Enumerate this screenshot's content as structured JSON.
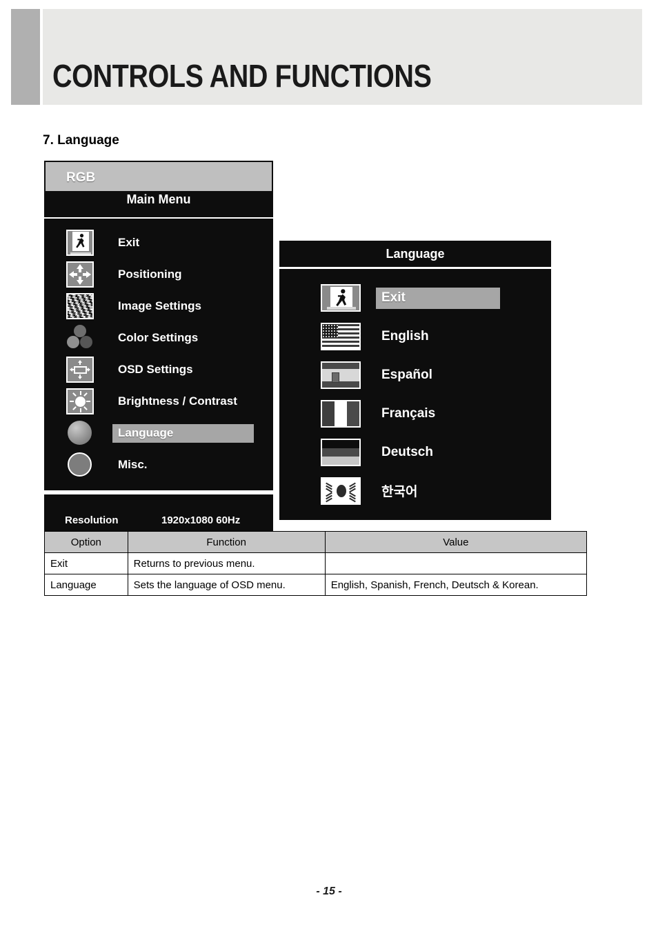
{
  "header": {
    "title": "CONTROLS AND FUNCTIONS",
    "accent_color": "#b0b0b0",
    "band_color": "#e8e8e6"
  },
  "section": {
    "heading": "7. Language"
  },
  "osd_main_menu": {
    "source_label": "RGB",
    "title": "Main Menu",
    "highlight_color": "#a6a6a6",
    "items": [
      {
        "label": "Exit",
        "icon": "exit-icon",
        "selected": false
      },
      {
        "label": "Positioning",
        "icon": "positioning-arrows-icon",
        "selected": false
      },
      {
        "label": "Image Settings",
        "icon": "image-noise-icon",
        "selected": false
      },
      {
        "label": "Color Settings",
        "icon": "color-circles-icon",
        "selected": false
      },
      {
        "label": "OSD Settings",
        "icon": "osd-frame-icon",
        "selected": false
      },
      {
        "label": "Brightness / Contrast",
        "icon": "sun-icon",
        "selected": false
      },
      {
        "label": "Language",
        "icon": "globe-icon",
        "selected": true
      },
      {
        "label": "Misc.",
        "icon": "circle-icon",
        "selected": false
      }
    ],
    "footer": {
      "resolution_label": "Resolution",
      "resolution_value": "1920x1080 60Hz"
    }
  },
  "osd_language_menu": {
    "title": "Language",
    "highlight_color": "#a6a6a6",
    "items": [
      {
        "label": "Exit",
        "icon": "exit-icon",
        "selected": true
      },
      {
        "label": "English",
        "icon": "flag-us-icon",
        "selected": false
      },
      {
        "label": "Español",
        "icon": "flag-es-icon",
        "selected": false
      },
      {
        "label": "Français",
        "icon": "flag-fr-icon",
        "selected": false
      },
      {
        "label": "Deutsch",
        "icon": "flag-de-icon",
        "selected": false
      },
      {
        "label": "한국어",
        "icon": "flag-kr-icon",
        "selected": false
      }
    ]
  },
  "spec_table": {
    "headers": [
      "Option",
      "Function",
      "Value"
    ],
    "rows": [
      {
        "option": "Exit",
        "function": "Returns to previous menu.",
        "value": ""
      },
      {
        "option": "Language",
        "function": "Sets the language of OSD menu.",
        "value": "English, Spanish, French, Deutsch & Korean."
      }
    ]
  },
  "footer": {
    "page_number": "- 15 -"
  }
}
